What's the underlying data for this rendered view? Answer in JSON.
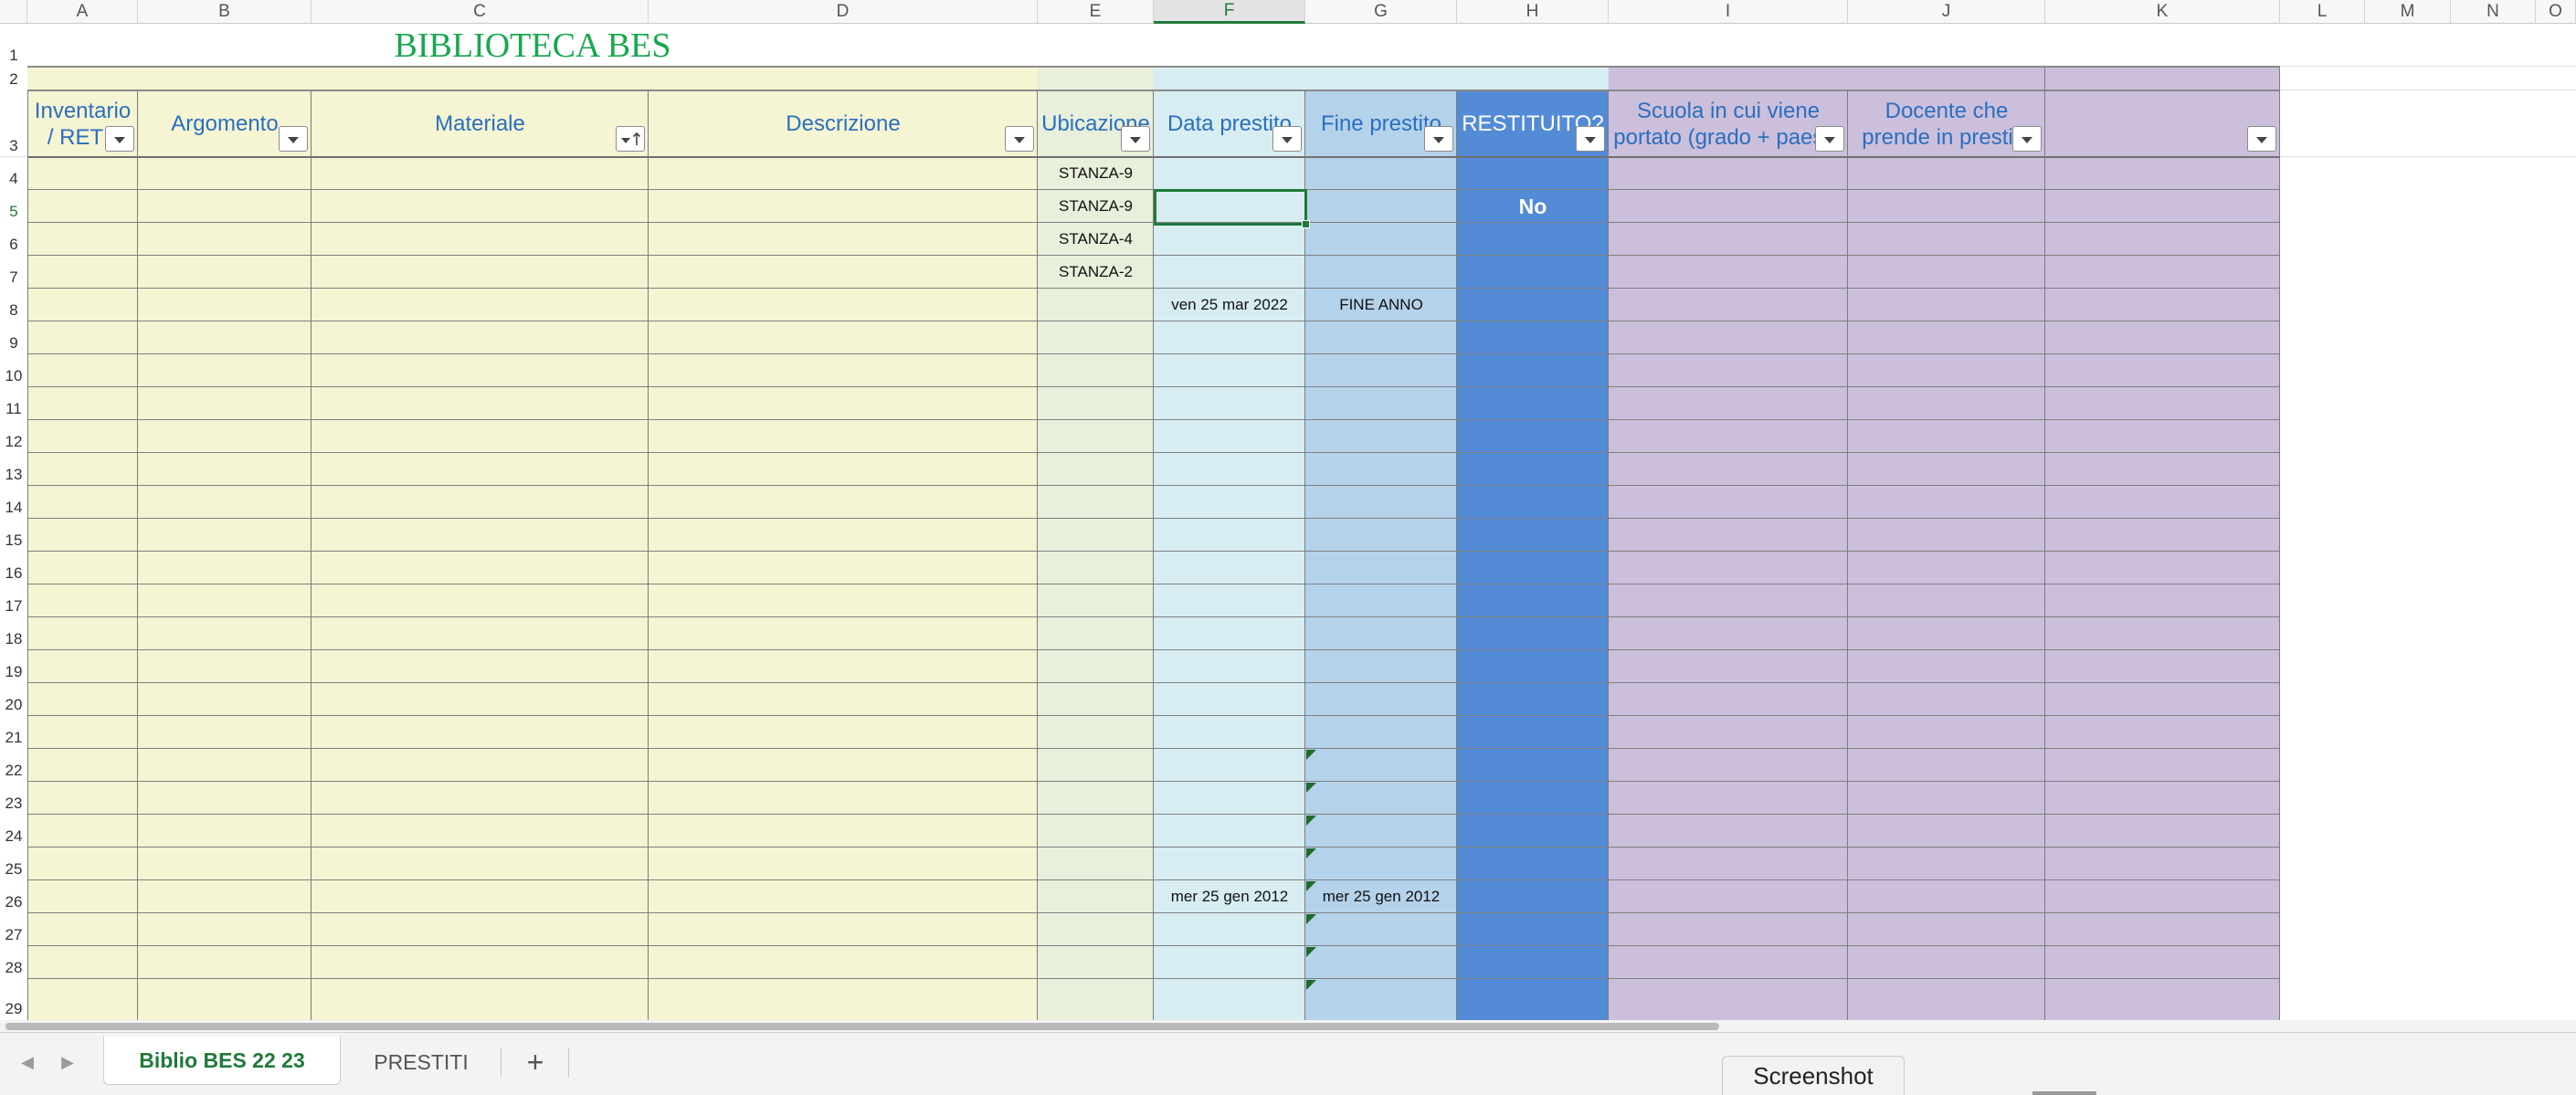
{
  "sheet": {
    "title": "BIBLIOTECA BES",
    "column_letters": [
      "A",
      "B",
      "C",
      "D",
      "E",
      "F",
      "G",
      "H",
      "I",
      "J",
      "K",
      "L",
      "M",
      "N",
      "O"
    ],
    "selected_column": "F",
    "selected_row": 5,
    "headers": [
      "Inventario\n/ RETE",
      "Argomento",
      "Materiale",
      "Descrizione",
      "Ubicazione",
      "Data prestito",
      "Fine prestito",
      "RESTITUITO?",
      "Scuola in cui viene\nportato (grado + paese)",
      "Docente che\nprende in prestito",
      ""
    ],
    "rows": [
      {
        "row": 4,
        "E": "STANZA-9"
      },
      {
        "row": 5,
        "E": "STANZA-9",
        "H": "No"
      },
      {
        "row": 6,
        "E": "STANZA-4"
      },
      {
        "row": 7,
        "E": "STANZA-2"
      },
      {
        "row": 8,
        "F": "ven 25 mar 2022",
        "G": "FINE ANNO"
      },
      {
        "row": 26,
        "F": "mer 25 gen 2012",
        "G": "mer 25 gen 2012"
      }
    ],
    "colors": {
      "yellow_zone": "#f5f4d3",
      "ubicazione_zone": "#e8efdb",
      "data_zone": "#d7edf1",
      "fine_zone": "#b5d2eb",
      "restituito_zone": "#548bd7",
      "purple_zone": "#ccbfdc",
      "title_green": "#18a84f",
      "header_text": "#2a6fbf"
    }
  },
  "tabs": [
    {
      "label": "Biblio BES 22 23",
      "active": true
    },
    {
      "label": "PRESTITI",
      "active": false
    }
  ],
  "add_sheet_label": "+",
  "tooltip": "Screenshot"
}
